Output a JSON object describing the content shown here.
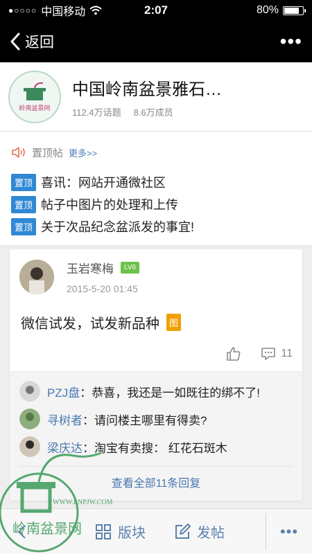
{
  "status": {
    "carrier": "中国移动",
    "time": "2:07",
    "battery": "80%",
    "battery_level": 0.8
  },
  "nav": {
    "back_label": "返回"
  },
  "forum": {
    "title": "中国岭南盆景雅石…",
    "topics": "112.4万话题",
    "members": "8.6万成员",
    "logo_text": "岭南盆景网"
  },
  "pinned": {
    "label": "置顶帖",
    "more": "更多>>",
    "badge": "置顶",
    "items": [
      {
        "text": "喜讯：网站开通微社区"
      },
      {
        "text": "帖子中图片的处理和上传"
      },
      {
        "text": "关于次品纪念盆派发的事宜!"
      }
    ]
  },
  "post": {
    "author": "玉岩寒梅",
    "level": "LV6",
    "time": "2015-5-20 01:45",
    "body": "微信试发，试发新品种",
    "image_badge": "图",
    "comments": "11"
  },
  "replies": [
    {
      "name": "PZJ盘",
      "sep": "：",
      "text": "恭喜，我还是一如既往的绑不了!"
    },
    {
      "name": "寻树者",
      "sep": "：",
      "text": "请问楼主哪里有得卖?"
    },
    {
      "name": "梁庆达",
      "sep": "：",
      "text": "淘宝有卖搜：  红花石斑木"
    }
  ],
  "view_all": "查看全部11条回复",
  "bottom_bar": {
    "boards": "版块",
    "post": "发帖"
  },
  "watermark_url": "WWW.LNPJW.COM",
  "watermark_text": "岭南盆景网",
  "colors": {
    "accent": "#2f88d4",
    "link": "#4a78b0",
    "level": "#6cc24a",
    "image_badge": "#f0a000"
  }
}
